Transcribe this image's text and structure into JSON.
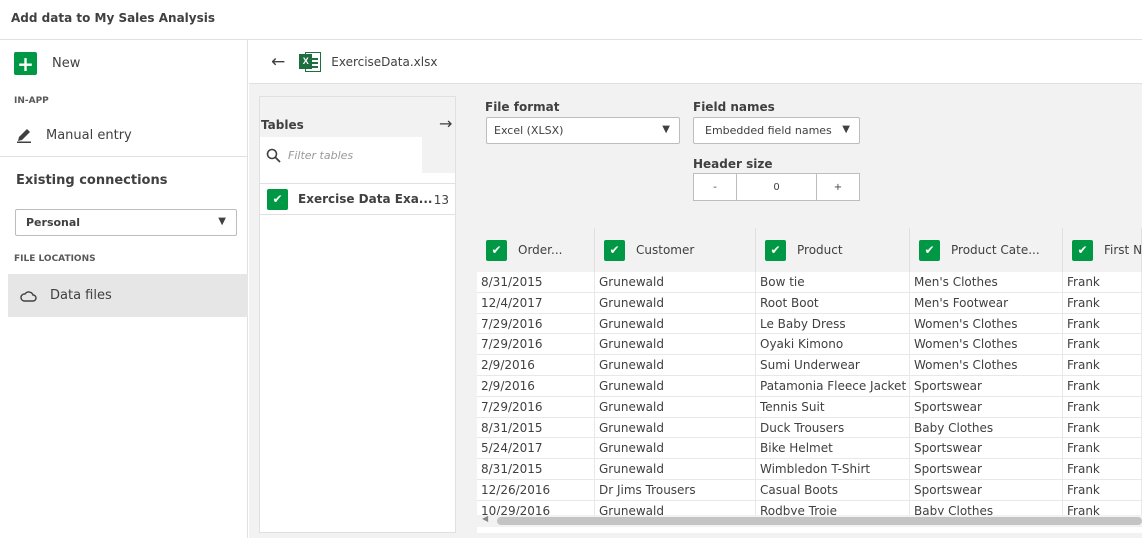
{
  "header": {
    "title": "Add data to My Sales Analysis"
  },
  "sidebar": {
    "new_label": "New",
    "in_app_label": "IN-APP",
    "manual_entry": "Manual entry",
    "existing_connections": "Existing connections",
    "space_select": "Personal",
    "file_locations_label": "FILE LOCATIONS",
    "data_files": "Data files"
  },
  "file": {
    "name": "ExerciseData.xlsx"
  },
  "tables": {
    "title": "Tables",
    "filter_placeholder": "Filter tables",
    "items": [
      {
        "label": "Exercise Data Exa...",
        "count": "13"
      }
    ]
  },
  "options": {
    "file_format_label": "File format",
    "file_format_value": "Excel (XLSX)",
    "field_names_label": "Field names",
    "field_names_value": "Embedded field names",
    "header_size_label": "Header size",
    "header_size_value": "0",
    "decrement": "-",
    "increment": "+"
  },
  "grid": {
    "columns": [
      "Order...",
      "Customer",
      "Product",
      "Product Cate...",
      "First N..."
    ],
    "rows": [
      [
        "8/31/2015",
        "Grunewald",
        "Bow tie",
        "Men's Clothes",
        "Frank"
      ],
      [
        "12/4/2017",
        "Grunewald",
        "Root Boot",
        "Men's Footwear",
        "Frank"
      ],
      [
        "7/29/2016",
        "Grunewald",
        "Le Baby Dress",
        "Women's Clothes",
        "Frank"
      ],
      [
        "7/29/2016",
        "Grunewald",
        "Oyaki Kimono",
        "Women's Clothes",
        "Frank"
      ],
      [
        "2/9/2016",
        "Grunewald",
        "Sumi Underwear",
        "Women's Clothes",
        "Frank"
      ],
      [
        "2/9/2016",
        "Grunewald",
        "Patamonia Fleece Jacket",
        "Sportswear",
        "Frank"
      ],
      [
        "7/29/2016",
        "Grunewald",
        "Tennis Suit",
        "Sportswear",
        "Frank"
      ],
      [
        "8/31/2015",
        "Grunewald",
        "Duck Trousers",
        "Baby Clothes",
        "Frank"
      ],
      [
        "5/24/2017",
        "Grunewald",
        "Bike Helmet",
        "Sportswear",
        "Frank"
      ],
      [
        "8/31/2015",
        "Grunewald",
        "Wimbledon T-Shirt",
        "Sportswear",
        "Frank"
      ],
      [
        "12/26/2016",
        "Dr Jims Trousers",
        "Casual Boots",
        "Sportswear",
        "Frank"
      ],
      [
        "10/29/2016",
        "Grunewald",
        "Rodbye Troje",
        "Baby Clothes",
        "Frank"
      ]
    ]
  },
  "colors": {
    "accent_green": "#009845",
    "excel_green": "#1d6f42",
    "panel_gray": "#f2f2f2"
  }
}
